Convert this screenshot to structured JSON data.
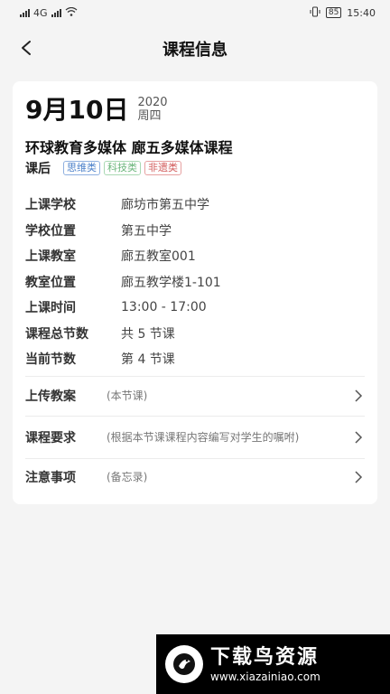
{
  "status_bar": {
    "time": "15:40",
    "battery": "85",
    "network": "4G"
  },
  "header": {
    "title": "课程信息"
  },
  "date": {
    "day": "9月10日",
    "year": "2020",
    "weekday": "周四"
  },
  "course": {
    "title": "环球教育多媒体 廊五多媒体课程",
    "type": "课后",
    "tags": [
      "思维类",
      "科技类",
      "非遗类"
    ]
  },
  "info": [
    {
      "label": "上课学校",
      "value": "廊坊市第五中学"
    },
    {
      "label": "学校位置",
      "value": "第五中学"
    },
    {
      "label": "上课教室",
      "value": "廊五教室001"
    },
    {
      "label": "教室位置",
      "value": "廊五教学楼1-101"
    },
    {
      "label": "上课时间",
      "value": "13:00 - 17:00"
    },
    {
      "label": "课程总节数",
      "value": "共 5 节课"
    },
    {
      "label": "当前节数",
      "value": "第 4 节课"
    }
  ],
  "links": [
    {
      "label": "上传教案",
      "hint": "(本节课)"
    },
    {
      "label": "课程要求",
      "hint": "(根据本节课课程内容编写对学生的嘱咐)"
    },
    {
      "label": "注意事项",
      "hint": "(备忘录)"
    }
  ],
  "watermark": {
    "title": "下载鸟资源",
    "url": "www.xiazainiao.com"
  },
  "colors": {
    "tag_blue": "#4a7fc9",
    "tag_green": "#6ab57a",
    "tag_red": "#d25a5a"
  }
}
